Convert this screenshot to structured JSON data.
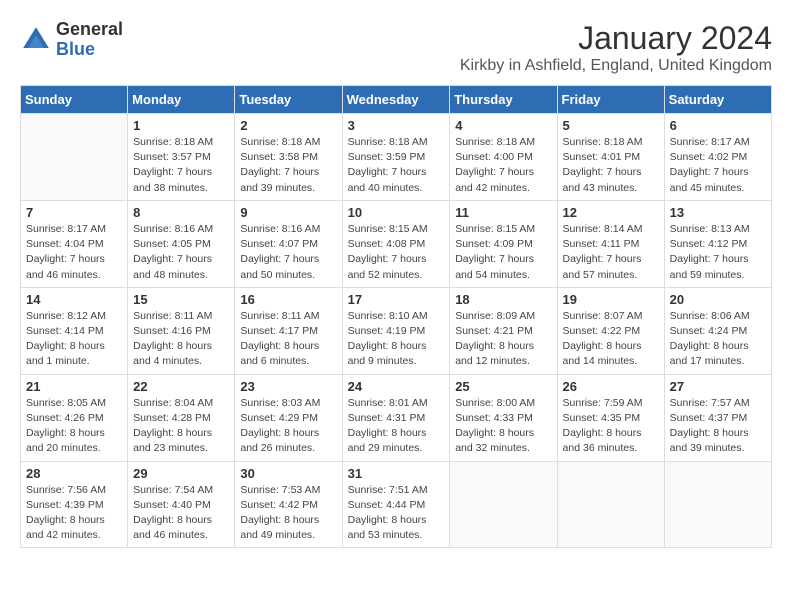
{
  "header": {
    "logo_general": "General",
    "logo_blue": "Blue",
    "title": "January 2024",
    "subtitle": "Kirkby in Ashfield, England, United Kingdom"
  },
  "weekdays": [
    "Sunday",
    "Monday",
    "Tuesday",
    "Wednesday",
    "Thursday",
    "Friday",
    "Saturday"
  ],
  "weeks": [
    [
      {
        "day": "",
        "info": ""
      },
      {
        "day": "1",
        "info": "Sunrise: 8:18 AM\nSunset: 3:57 PM\nDaylight: 7 hours\nand 38 minutes."
      },
      {
        "day": "2",
        "info": "Sunrise: 8:18 AM\nSunset: 3:58 PM\nDaylight: 7 hours\nand 39 minutes."
      },
      {
        "day": "3",
        "info": "Sunrise: 8:18 AM\nSunset: 3:59 PM\nDaylight: 7 hours\nand 40 minutes."
      },
      {
        "day": "4",
        "info": "Sunrise: 8:18 AM\nSunset: 4:00 PM\nDaylight: 7 hours\nand 42 minutes."
      },
      {
        "day": "5",
        "info": "Sunrise: 8:18 AM\nSunset: 4:01 PM\nDaylight: 7 hours\nand 43 minutes."
      },
      {
        "day": "6",
        "info": "Sunrise: 8:17 AM\nSunset: 4:02 PM\nDaylight: 7 hours\nand 45 minutes."
      }
    ],
    [
      {
        "day": "7",
        "info": "Sunrise: 8:17 AM\nSunset: 4:04 PM\nDaylight: 7 hours\nand 46 minutes."
      },
      {
        "day": "8",
        "info": "Sunrise: 8:16 AM\nSunset: 4:05 PM\nDaylight: 7 hours\nand 48 minutes."
      },
      {
        "day": "9",
        "info": "Sunrise: 8:16 AM\nSunset: 4:07 PM\nDaylight: 7 hours\nand 50 minutes."
      },
      {
        "day": "10",
        "info": "Sunrise: 8:15 AM\nSunset: 4:08 PM\nDaylight: 7 hours\nand 52 minutes."
      },
      {
        "day": "11",
        "info": "Sunrise: 8:15 AM\nSunset: 4:09 PM\nDaylight: 7 hours\nand 54 minutes."
      },
      {
        "day": "12",
        "info": "Sunrise: 8:14 AM\nSunset: 4:11 PM\nDaylight: 7 hours\nand 57 minutes."
      },
      {
        "day": "13",
        "info": "Sunrise: 8:13 AM\nSunset: 4:12 PM\nDaylight: 7 hours\nand 59 minutes."
      }
    ],
    [
      {
        "day": "14",
        "info": "Sunrise: 8:12 AM\nSunset: 4:14 PM\nDaylight: 8 hours\nand 1 minute."
      },
      {
        "day": "15",
        "info": "Sunrise: 8:11 AM\nSunset: 4:16 PM\nDaylight: 8 hours\nand 4 minutes."
      },
      {
        "day": "16",
        "info": "Sunrise: 8:11 AM\nSunset: 4:17 PM\nDaylight: 8 hours\nand 6 minutes."
      },
      {
        "day": "17",
        "info": "Sunrise: 8:10 AM\nSunset: 4:19 PM\nDaylight: 8 hours\nand 9 minutes."
      },
      {
        "day": "18",
        "info": "Sunrise: 8:09 AM\nSunset: 4:21 PM\nDaylight: 8 hours\nand 12 minutes."
      },
      {
        "day": "19",
        "info": "Sunrise: 8:07 AM\nSunset: 4:22 PM\nDaylight: 8 hours\nand 14 minutes."
      },
      {
        "day": "20",
        "info": "Sunrise: 8:06 AM\nSunset: 4:24 PM\nDaylight: 8 hours\nand 17 minutes."
      }
    ],
    [
      {
        "day": "21",
        "info": "Sunrise: 8:05 AM\nSunset: 4:26 PM\nDaylight: 8 hours\nand 20 minutes."
      },
      {
        "day": "22",
        "info": "Sunrise: 8:04 AM\nSunset: 4:28 PM\nDaylight: 8 hours\nand 23 minutes."
      },
      {
        "day": "23",
        "info": "Sunrise: 8:03 AM\nSunset: 4:29 PM\nDaylight: 8 hours\nand 26 minutes."
      },
      {
        "day": "24",
        "info": "Sunrise: 8:01 AM\nSunset: 4:31 PM\nDaylight: 8 hours\nand 29 minutes."
      },
      {
        "day": "25",
        "info": "Sunrise: 8:00 AM\nSunset: 4:33 PM\nDaylight: 8 hours\nand 32 minutes."
      },
      {
        "day": "26",
        "info": "Sunrise: 7:59 AM\nSunset: 4:35 PM\nDaylight: 8 hours\nand 36 minutes."
      },
      {
        "day": "27",
        "info": "Sunrise: 7:57 AM\nSunset: 4:37 PM\nDaylight: 8 hours\nand 39 minutes."
      }
    ],
    [
      {
        "day": "28",
        "info": "Sunrise: 7:56 AM\nSunset: 4:39 PM\nDaylight: 8 hours\nand 42 minutes."
      },
      {
        "day": "29",
        "info": "Sunrise: 7:54 AM\nSunset: 4:40 PM\nDaylight: 8 hours\nand 46 minutes."
      },
      {
        "day": "30",
        "info": "Sunrise: 7:53 AM\nSunset: 4:42 PM\nDaylight: 8 hours\nand 49 minutes."
      },
      {
        "day": "31",
        "info": "Sunrise: 7:51 AM\nSunset: 4:44 PM\nDaylight: 8 hours\nand 53 minutes."
      },
      {
        "day": "",
        "info": ""
      },
      {
        "day": "",
        "info": ""
      },
      {
        "day": "",
        "info": ""
      }
    ]
  ]
}
